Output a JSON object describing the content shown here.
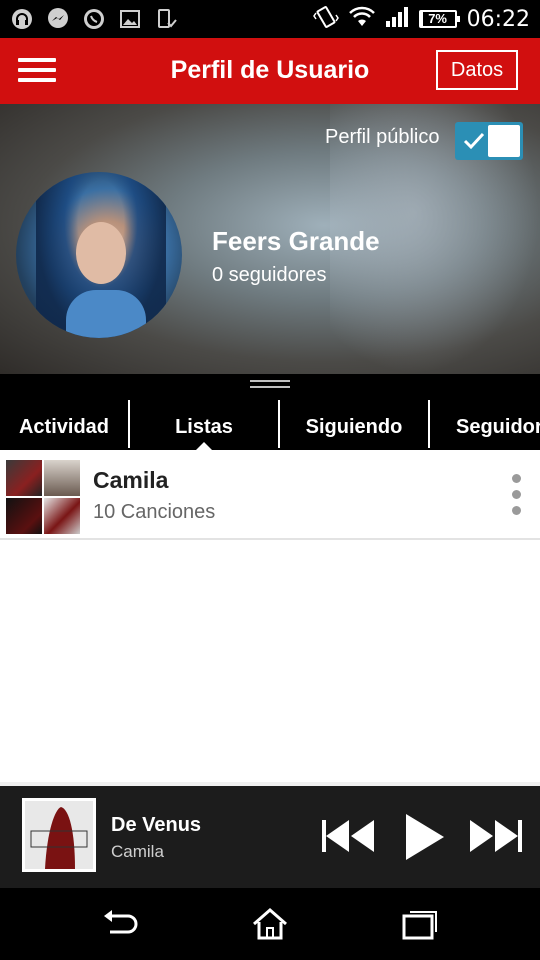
{
  "status_bar": {
    "battery": "7%",
    "battery_level": 0.07,
    "time": "06:22",
    "icons": [
      "headset-icon",
      "messenger-icon",
      "whatsapp-icon",
      "image-icon",
      "phone-check-icon",
      "vibrate-icon",
      "wifi-icon",
      "signal-icon",
      "battery-icon"
    ]
  },
  "app_bar": {
    "title": "Perfil de Usuario",
    "datos_label": "Datos"
  },
  "profile": {
    "public_label": "Perfil público",
    "public_enabled": true,
    "name": "Feers Grande",
    "followers": "0 seguidores"
  },
  "tabs": [
    {
      "label": "Actividad",
      "active": false
    },
    {
      "label": "Listas",
      "active": true
    },
    {
      "label": "Siguiendo",
      "active": false
    },
    {
      "label": "Seguidores",
      "active": false
    }
  ],
  "playlists": [
    {
      "title": "Camila",
      "subtitle": "10 Canciones"
    }
  ],
  "now_playing": {
    "title": "De Venus",
    "artist": "Camila"
  },
  "colors": {
    "brand_red": "#d10f0f",
    "toggle_blue": "#2b8fb5",
    "player_bg": "#1c1c1c"
  }
}
